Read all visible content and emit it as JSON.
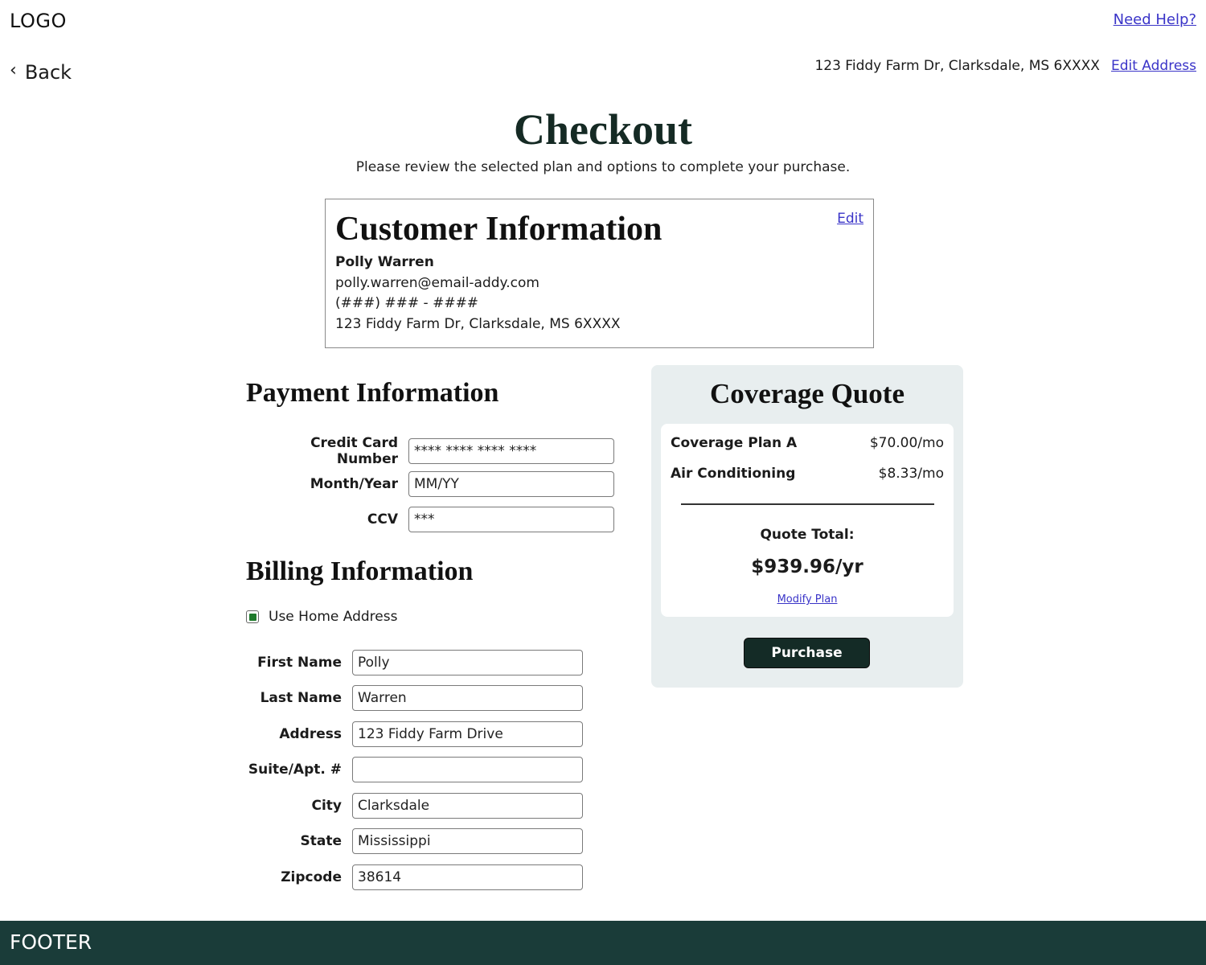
{
  "header": {
    "logo": "LOGO",
    "help_link": "Need Help?",
    "back_label": "Back",
    "address": "123 Fiddy Farm Dr, Clarksdale, MS 6XXXX",
    "edit_address_link": "Edit Address"
  },
  "page": {
    "title": "Checkout",
    "subtitle": "Please review the selected plan and options to complete your purchase."
  },
  "customer": {
    "title": "Customer Information",
    "edit_link": "Edit",
    "name": "Polly Warren",
    "email": "polly.warren@email-addy.com",
    "phone": "(###) ### - ####",
    "address": "123 Fiddy Farm Dr, Clarksdale, MS 6XXXX"
  },
  "payment": {
    "title": "Payment Information",
    "fields": [
      {
        "label": "Credit Card Number",
        "value": "**** **** **** ****"
      },
      {
        "label": "Month/Year",
        "value": "MM/YY"
      },
      {
        "label": "CCV",
        "value": "***"
      }
    ]
  },
  "billing": {
    "title": "Billing Information",
    "use_home_address_label": "Use Home Address",
    "use_home_address_checked": true,
    "fields": [
      {
        "label": "First Name",
        "value": "Polly"
      },
      {
        "label": "Last Name",
        "value": "Warren"
      },
      {
        "label": "Address",
        "value": "123 Fiddy Farm Drive"
      },
      {
        "label": "Suite/Apt. #",
        "value": ""
      },
      {
        "label": "City",
        "value": "Clarksdale"
      },
      {
        "label": "State",
        "value": "Mississippi"
      },
      {
        "label": "Zipcode",
        "value": "38614"
      }
    ]
  },
  "quote": {
    "title": "Coverage Quote",
    "items": [
      {
        "label": "Coverage Plan A",
        "price": "$70.00/mo"
      },
      {
        "label": "Air Conditioning",
        "price": "$8.33/mo"
      }
    ],
    "total_label": "Quote Total:",
    "total_value": "$939.96/yr",
    "modify_link": "Modify Plan",
    "purchase_label": "Purchase"
  },
  "footer": {
    "text": "FOOTER"
  },
  "colors": {
    "accent_dark": "#142b26",
    "footer_bg": "#1a3c39",
    "quote_panel_bg": "#e8eeef",
    "link": "#3a34c8",
    "checkbox_fill": "#1f7a2c"
  }
}
